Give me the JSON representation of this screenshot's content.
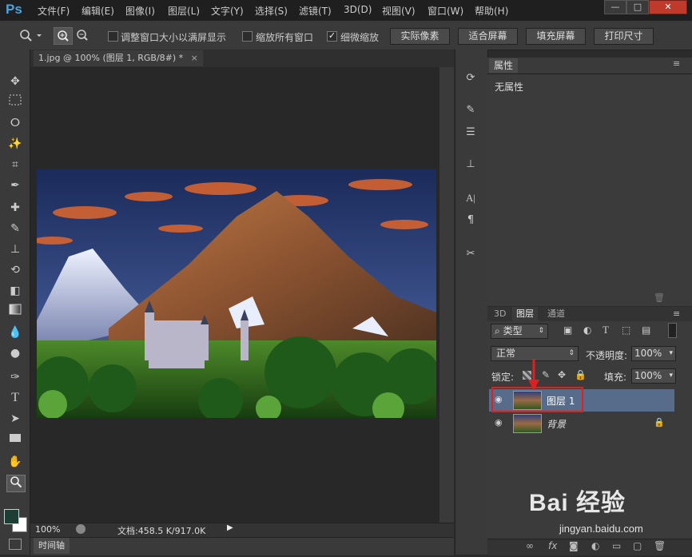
{
  "app": {
    "logo": "Ps"
  },
  "menu": [
    "文件(F)",
    "编辑(E)",
    "图像(I)",
    "图层(L)",
    "文字(Y)",
    "选择(S)",
    "滤镜(T)",
    "3D(D)",
    "视图(V)",
    "窗口(W)",
    "帮助(H)"
  ],
  "window_controls": {
    "minimize": "—",
    "restore": "□",
    "close": "✕"
  },
  "options": {
    "resize_window": "调整窗口大小以满屏显示",
    "zoom_all_windows": "缩放所有窗口",
    "scrubby_zoom": "细微缩放",
    "scrubby_checked": true,
    "btn_actual": "实际像素",
    "btn_fit": "适合屏幕",
    "btn_fill": "填充屏幕",
    "btn_print": "打印尺寸"
  },
  "document": {
    "tab_title": "1.jpg @ 100% (图层 1, RGB/8#) *",
    "zoom": "100%",
    "doc_info": "文档:458.5 K/917.0K",
    "timeline": "时间轴"
  },
  "properties": {
    "title": "属性",
    "content": "无属性"
  },
  "layers_panel": {
    "tabs": [
      "3D",
      "图层",
      "通道"
    ],
    "active_tab": "图层",
    "filter_kind": "类型",
    "blend_mode": "正常",
    "opacity_label": "不透明度:",
    "opacity": "100%",
    "lock_label": "锁定:",
    "fill_label": "填充:",
    "fill": "100%",
    "layers": [
      {
        "name": "图层 1",
        "selected": true
      },
      {
        "name": "背景",
        "selected": false,
        "locked": true
      }
    ]
  },
  "watermark": {
    "brand": "Bai 经验",
    "url": "jingyan.baidu.com"
  },
  "colors": {
    "accent": "#4aa3df",
    "highlight_box": "#e02020",
    "selected_layer": "#576b8a"
  }
}
